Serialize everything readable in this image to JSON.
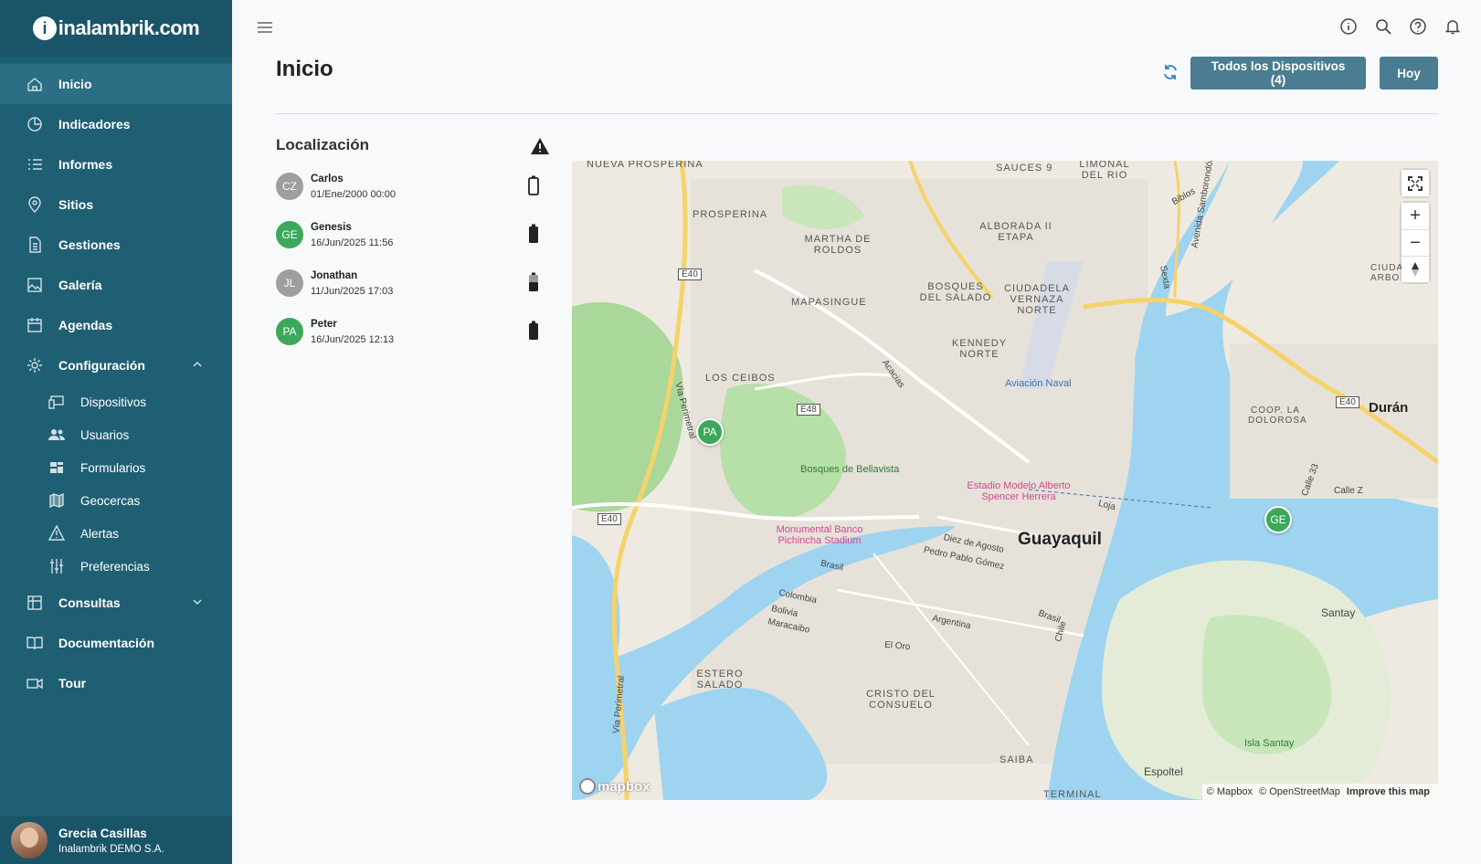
{
  "sidebar": {
    "logo_text": "inalambrik.com",
    "logo_letter": "i",
    "items": [
      {
        "label": "Inicio",
        "icon": "home-icon",
        "active": true
      },
      {
        "label": "Indicadores",
        "icon": "pie-chart-icon"
      },
      {
        "label": "Informes",
        "icon": "list-icon"
      },
      {
        "label": "Sitios",
        "icon": "location-pin-icon"
      },
      {
        "label": "Gestiones",
        "icon": "document-icon"
      },
      {
        "label": "Galería",
        "icon": "image-icon"
      },
      {
        "label": "Agendas",
        "icon": "calendar-icon"
      },
      {
        "label": "Configuración",
        "icon": "gear-icon",
        "expanded": true
      },
      {
        "label": "Consultas",
        "icon": "table-icon",
        "expanded": false
      },
      {
        "label": "Documentación",
        "icon": "book-icon"
      },
      {
        "label": "Tour",
        "icon": "video-camera-icon"
      }
    ],
    "config_subitems": [
      {
        "label": "Dispositivos",
        "icon": "devices-icon"
      },
      {
        "label": "Usuarios",
        "icon": "users-icon"
      },
      {
        "label": "Formularios",
        "icon": "forms-icon"
      },
      {
        "label": "Geocercas",
        "icon": "map-icon"
      },
      {
        "label": "Alertas",
        "icon": "warning-icon"
      },
      {
        "label": "Preferencias",
        "icon": "sliders-icon"
      }
    ],
    "user": {
      "name": "Grecia Casillas",
      "org": "Inalambrik DEMO S.A."
    }
  },
  "topbar": {
    "icons": [
      "info-icon",
      "search-icon",
      "help-icon",
      "bell-icon"
    ]
  },
  "header": {
    "title": "Inicio",
    "devices_button": "Todos los Dispositivos (4)",
    "today_button": "Hoy"
  },
  "location": {
    "title": "Localización",
    "devices": [
      {
        "initials": "CZ",
        "name": "Carlos",
        "time": "01/Ene/2000 00:00",
        "color": "#9e9e9e",
        "battery": "empty"
      },
      {
        "initials": "GE",
        "name": "Genesis",
        "time": "16/Jun/2025 11:56",
        "color": "#3ba85a",
        "battery": "full"
      },
      {
        "initials": "JL",
        "name": "Jonathan",
        "time": "11/Jun/2025 17:03",
        "color": "#9e9e9e",
        "battery": "half"
      },
      {
        "initials": "PA",
        "name": "Peter",
        "time": "16/Jun/2025 12:13",
        "color": "#3ba85a",
        "battery": "full"
      }
    ]
  },
  "map": {
    "labels": {
      "nueva_prosperina": "NUEVA PROSPERINA",
      "prosperina": "PROSPERINA",
      "martha_de_roldos": "MARTHA DE ROLDOS",
      "mapasingue": "MAPASINGUE",
      "los_ceibos": "LOS CEIBOS",
      "sauces": "SAUCES 9",
      "limonal": "LIMONAL DEL RIO",
      "alborada": "ALBORADA II ETAPA",
      "bosques_salado": "BOSQUES DEL SALADO",
      "ciudadela": "CIUDADELA VERNAZA NORTE",
      "kennedy": "KENNEDY NORTE",
      "aviacion": "Aviación Naval",
      "bosques_bellavista": "Bosques de Bellavista",
      "estadio_modelo": "Estadio Modelo Alberto Spencer Herrera",
      "monumental": "Monumental Banco Pichincha Stadium",
      "guayaquil": "Guayaquil",
      "duran": "Durán",
      "coop_dolorosa": "COOP. LA DOLOROSA",
      "santay": "Santay",
      "isla_santay": "Isla Santay",
      "estero_salado": "ESTERO SALADO",
      "cristo_consuelo": "CRISTO DEL CONSUELO",
      "saiba": "SAIBA",
      "espoltel": "Espoltel",
      "terminal": "TERMINAL",
      "ciuda": "CIUDA ARBO",
      "biblos": "Biblos",
      "av_samborondon": "Avenida Samborondón",
      "sexta": "Sexta",
      "via_perimetral": "Vía Perimetral",
      "acacias": "Acacias",
      "loja": "Loja",
      "diez_agosto": "Diez de Agosto",
      "pedro_pablo": "Pedro Pablo Gómez",
      "brasil": "Brasil",
      "colombia": "Colombia",
      "bolivia": "Bolivia",
      "maracaibo": "Maracaibo",
      "argentina": "Argentina",
      "el_oro": "El Oro",
      "chile": "Chile",
      "calle_z": "Calle Z",
      "calle_33": "Calle 33",
      "e40": "E40",
      "e48": "E48"
    },
    "markers": [
      {
        "initials": "PA",
        "name": "Peter"
      },
      {
        "initials": "GE",
        "name": "Genesis"
      }
    ],
    "attribution": {
      "mapbox": "© Mapbox",
      "osm": "© OpenStreetMap",
      "improve": "Improve this map"
    },
    "logo": "mapbox"
  },
  "colors": {
    "sidebar": "#1f5f74",
    "sidebar_dark": "#1a5468",
    "button": "#4a7d91",
    "marker_green": "#3ba85a",
    "water": "#9fd4f0",
    "park": "#b7dfa8"
  }
}
